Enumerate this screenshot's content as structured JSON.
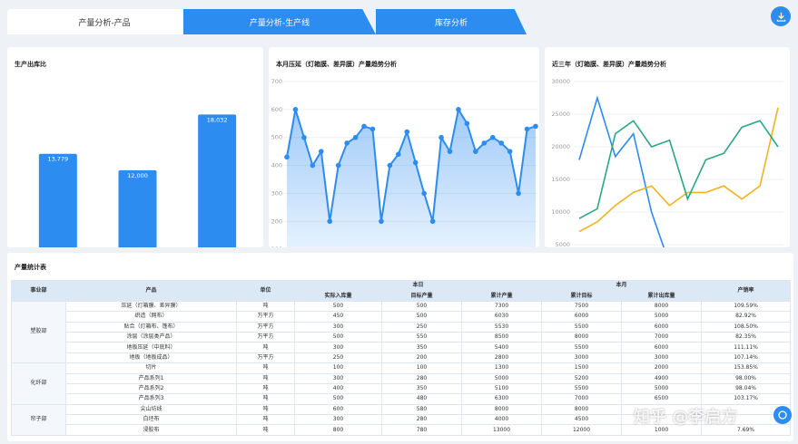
{
  "tabs": [
    {
      "label": "产量分析-产品"
    },
    {
      "label": "产量分析-生产线"
    },
    {
      "label": "库存分析"
    }
  ],
  "icons": {
    "download": "download-icon",
    "float": "chat-icon"
  },
  "colors": {
    "accent": "#2d8cf0",
    "line1": "#2d8cf0",
    "line2": "#f0b323",
    "line3": "#2aa58a"
  },
  "panels": {
    "bar_title": "生产出库比",
    "line_title": "本月压延（灯箱膜、差异膜）产量趋势分析",
    "multi_title": "近三年（灯箱膜、差异膜）产量趋势分析",
    "table_title": "产量统计表"
  },
  "chart_data": [
    {
      "type": "bar",
      "categories": [
        "本月产量",
        "目标产量",
        "本月出库量"
      ],
      "values": [
        13779,
        12000,
        18032
      ],
      "value_labels": [
        "13,779",
        "12,000",
        "18,032"
      ],
      "ylim": [
        0,
        22000
      ],
      "color": "#2d8cf0"
    },
    {
      "type": "area",
      "x": [
        "1",
        "2",
        "3",
        "4",
        "5",
        "6",
        "7",
        "8",
        "9",
        "10",
        "11",
        "12",
        "13",
        "14",
        "15",
        "16",
        "17",
        "18",
        "19",
        "20",
        "21",
        "22",
        "23",
        "24",
        "25",
        "26",
        "27",
        "28",
        "29",
        "30"
      ],
      "values": [
        430,
        600,
        500,
        400,
        450,
        200,
        400,
        480,
        500,
        540,
        530,
        200,
        400,
        440,
        520,
        410,
        300,
        200,
        500,
        450,
        600,
        550,
        450,
        480,
        500,
        480,
        450,
        300,
        530,
        540
      ],
      "yticks": [
        "0",
        "100",
        "200",
        "300",
        "400",
        "500",
        "600",
        "700"
      ],
      "ylim": [
        0,
        700
      ],
      "grid": true,
      "color": "#2d8cf0"
    },
    {
      "type": "line",
      "x": [
        "01",
        "02",
        "03",
        "04",
        "05",
        "06",
        "07",
        "08",
        "09",
        "10",
        "11",
        "12"
      ],
      "series": [
        {
          "values": [
            18000,
            27500,
            18500,
            22000,
            10000,
            2000,
            null,
            null,
            null,
            null,
            null,
            null
          ],
          "color": "#2d8cf0"
        },
        {
          "values": [
            7000,
            8500,
            11000,
            13000,
            14000,
            11000,
            13000,
            13000,
            14000,
            12000,
            14000,
            26000
          ],
          "color": "#f0b323"
        },
        {
          "values": [
            9000,
            10500,
            22000,
            24000,
            20000,
            21000,
            12000,
            18000,
            19000,
            23000,
            24000,
            20000
          ],
          "color": "#2aa58a"
        }
      ],
      "yticks": [
        "0",
        "5000",
        "10000",
        "15000",
        "20000",
        "25000",
        "30000"
      ],
      "ylim": [
        0,
        30000
      ],
      "grid": true
    }
  ],
  "table": {
    "headers": {
      "division": "事业部",
      "product": "产品",
      "unit": "单位",
      "day": "本日",
      "month": "本月",
      "rate": "产销率",
      "actual_in": "实际入库量",
      "target": "目标产量",
      "cum": "累计产量",
      "cum_target": "累计目标",
      "cum_out": "累计出库量"
    },
    "groups": [
      {
        "division": "塑胶部",
        "rows": [
          {
            "product": "压延（灯箱膜、差异膜）",
            "unit": "吨",
            "actual": "500",
            "target": "500",
            "cum": "7300",
            "cum_target": "7500",
            "cum_out": "8000",
            "rate": "109.59%"
          },
          {
            "product": "织造（网布）",
            "unit": "万平方",
            "actual": "450",
            "target": "500",
            "cum": "6030",
            "cum_target": "6000",
            "cum_out": "5000",
            "rate": "82.92%"
          },
          {
            "product": "贴合（灯箱布、篷布）",
            "unit": "万平方",
            "actual": "300",
            "target": "250",
            "cum": "5530",
            "cum_target": "5500",
            "cum_out": "6000",
            "rate": "108.50%"
          },
          {
            "product": "涂层（涂层类产品）",
            "unit": "万平方",
            "actual": "500",
            "target": "550",
            "cum": "8500",
            "cum_target": "8000",
            "cum_out": "7000",
            "rate": "82.35%"
          },
          {
            "product": "地板压延（中底料）",
            "unit": "吨",
            "actual": "300",
            "target": "350",
            "cum": "5400",
            "cum_target": "5500",
            "cum_out": "6000",
            "rate": "111.11%"
          },
          {
            "product": "地板（地板成品）",
            "unit": "万平方",
            "actual": "250",
            "target": "200",
            "cum": "2800",
            "cum_target": "3000",
            "cum_out": "3000",
            "rate": "107.14%"
          }
        ]
      },
      {
        "division": "化纤部",
        "rows": [
          {
            "product": "切片",
            "unit": "吨",
            "actual": "100",
            "target": "100",
            "cum": "1300",
            "cum_target": "1500",
            "cum_out": "2000",
            "rate": "153.85%"
          },
          {
            "product": "产品系列1",
            "unit": "吨",
            "actual": "300",
            "target": "280",
            "cum": "5000",
            "cum_target": "5200",
            "cum_out": "4900",
            "rate": "98.00%"
          },
          {
            "product": "产品系列2",
            "unit": "吨",
            "actual": "400",
            "target": "350",
            "cum": "5100",
            "cum_target": "5500",
            "cum_out": "5000",
            "rate": "98.04%"
          },
          {
            "product": "产品系列3",
            "unit": "吨",
            "actual": "500",
            "target": "480",
            "cum": "6300",
            "cum_target": "7000",
            "cum_out": "6500",
            "rate": "103.17%"
          }
        ]
      },
      {
        "division": "帘子部",
        "rows": [
          {
            "product": "尖山坊线",
            "unit": "吨",
            "actual": "600",
            "target": "580",
            "cum": "8000",
            "cum_target": "8000",
            "cum_out": "",
            "rate": ""
          },
          {
            "product": "白坯布",
            "unit": "吨",
            "actual": "300",
            "target": "280",
            "cum": "4000",
            "cum_target": "4500",
            "cum_out": "",
            "rate": ""
          },
          {
            "product": "浸胶布",
            "unit": "吨",
            "actual": "800",
            "target": "780",
            "cum": "13000",
            "cum_target": "12000",
            "cum_out": "1000",
            "rate": "7.69%"
          }
        ]
      }
    ]
  },
  "watermark": "知乎 @李启方"
}
